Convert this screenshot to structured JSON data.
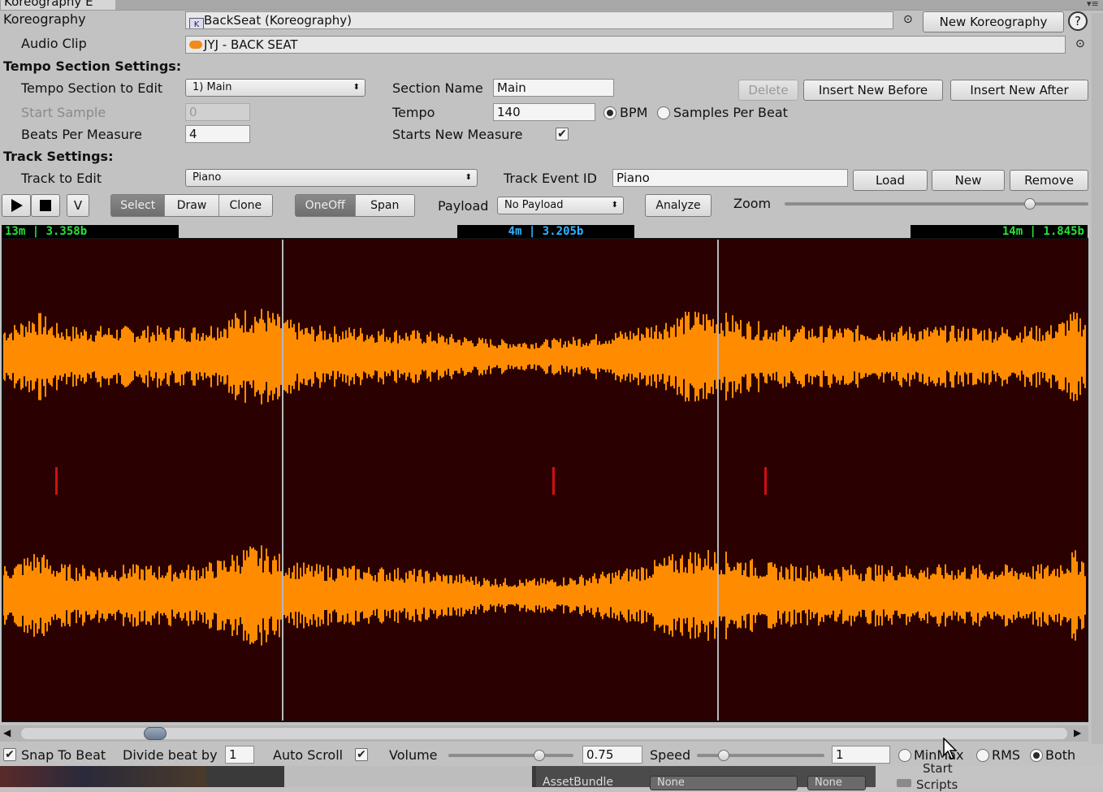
{
  "window": {
    "tab_title": "Koreography E"
  },
  "header": {
    "koreography_label": "Koreography",
    "koreography_value": "BackSeat (Koreography)",
    "new_koreography_label": "New Koreography",
    "help_label": "?",
    "audio_clip_label": "Audio Clip",
    "audio_clip_value": "JYJ - BACK SEAT"
  },
  "tempo": {
    "heading": "Tempo Section Settings:",
    "section_to_edit_label": "Tempo Section to Edit",
    "section_to_edit_value": "1) Main",
    "section_name_label": "Section Name",
    "section_name_value": "Main",
    "delete_label": "Delete",
    "insert_before_label": "Insert New Before",
    "insert_after_label": "Insert New After",
    "start_sample_label": "Start Sample",
    "start_sample_value": "0",
    "tempo_label": "Tempo",
    "tempo_value": "140",
    "bpm_label": "BPM",
    "samples_per_beat_label": "Samples Per Beat",
    "beats_per_measure_label": "Beats Per Measure",
    "beats_per_measure_value": "4",
    "starts_new_measure_label": "Starts New Measure",
    "starts_new_measure_checked": true
  },
  "track": {
    "heading": "Track Settings:",
    "track_to_edit_label": "Track to Edit",
    "track_to_edit_value": "Piano",
    "event_id_label": "Track Event ID",
    "event_id_value": "Piano",
    "load_label": "Load",
    "new_label": "New",
    "remove_label": "Remove"
  },
  "toolbar": {
    "v_label": "V",
    "modes": [
      "Select",
      "Draw",
      "Clone"
    ],
    "active_mode": "Select",
    "event_types": [
      "OneOff",
      "Span"
    ],
    "active_event_type": "OneOff",
    "payload_label": "Payload",
    "payload_value": "No Payload",
    "analyze_label": "Analyze",
    "zoom_label": "Zoom",
    "zoom_level": 0.82
  },
  "waveform": {
    "left_time": "13m | 3.358b",
    "center_time": "4m | 3.205b",
    "right_time": "14m | 1.845b",
    "wave_color": "#ff8c00",
    "background_color": "#2a0000",
    "event_marker_color": "#d01010",
    "scroll_position": 0.12
  },
  "footer": {
    "snap_to_beat_label": "Snap To Beat",
    "snap_to_beat_checked": true,
    "divide_beat_label": "Divide beat by",
    "divide_beat_value": "1",
    "auto_scroll_label": "Auto Scroll",
    "auto_scroll_checked": true,
    "volume_label": "Volume",
    "volume_value": "0.75",
    "speed_label": "Speed",
    "speed_value": "1",
    "minmax_label": "MinMax",
    "rms_label": "RMS",
    "both_label": "Both",
    "selected_display_mode": "Both"
  },
  "background_panel": {
    "start_label": "Start",
    "assetbundle_label": "AssetBundle",
    "assetbundle_value": "None",
    "assetbundle_variant_value": "None",
    "scripts_label": "Scripts"
  }
}
